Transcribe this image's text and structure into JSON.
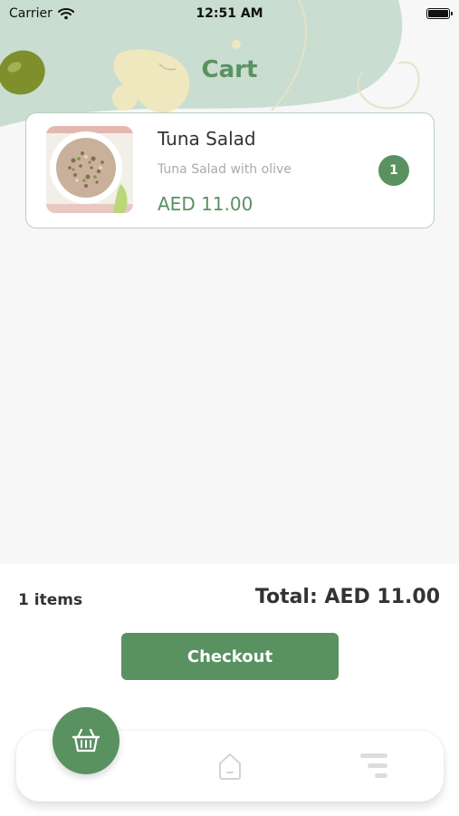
{
  "status_bar": {
    "carrier": "Carrier",
    "time": "12:51 AM"
  },
  "header": {
    "title": "Cart"
  },
  "cart_items": [
    {
      "name": "Tuna Salad",
      "description": "Tuna Salad with olive",
      "price": "AED 11.00",
      "quantity": "1"
    }
  ],
  "summary": {
    "items_count": "1 items",
    "total": "Total: AED 11.00"
  },
  "actions": {
    "checkout_label": "Checkout"
  },
  "tab_bar": {
    "icons": [
      "basket-icon",
      "home-icon",
      "menu-icon"
    ]
  },
  "colors": {
    "accent": "#5a9161",
    "header_bg": "#c9ddd0",
    "card_border": "#b7d0bb",
    "page_bg": "#f7f7f7"
  }
}
